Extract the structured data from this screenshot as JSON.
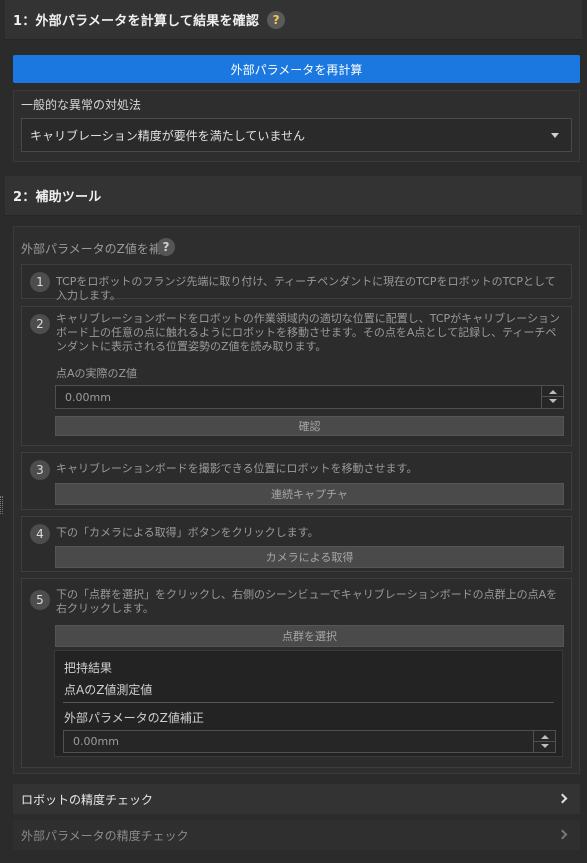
{
  "section1": {
    "title": "1：外部パラメータを計算して結果を確認",
    "help": "?",
    "recalc_button": "外部パラメータを再計算",
    "common_issues_label": "一般的な異常の対処法",
    "issue_selected": "キャリブレーション精度が要件を満たしていません"
  },
  "section2": {
    "title": "2：補助ツール",
    "z_correction_label": "外部パラメータのZ値を補正",
    "help": "?",
    "steps": [
      {
        "num": "1",
        "text": "TCPをロボットのフランジ先端に取り付け、ティーチペンダントに現在のTCPをロボットのTCPとして入力します。"
      },
      {
        "num": "2",
        "text": "キャリブレーションボードをロボットの作業領域内の適切な位置に配置し、TCPがキャリブレーションボード上の任意の点に触れるようにロボットを移動させます。その点をA点として記録し、ティーチペンダントに表示される位置姿勢のZ値を読み取ります。",
        "field_label": "点Aの実際のZ値",
        "field_value": "0.00mm",
        "button": "確認"
      },
      {
        "num": "3",
        "text": "キャリブレーションボードを撮影できる位置にロボットを移動させます。",
        "button": "連続キャプチャ"
      },
      {
        "num": "4",
        "text": "下の「カメラによる取得」ボタンをクリックします。",
        "button": "カメラによる取得"
      },
      {
        "num": "5",
        "text": "下の「点群を選択」をクリックし、右側のシーンビューでキャリブレーションボードの点群上の点Aを右クリックします。",
        "button": "点群を選択",
        "result_title": "把持結果",
        "result_z_label": "点AのZ値測定値",
        "correction_label": "外部パラメータのZ値補正",
        "correction_value": "0.00mm"
      }
    ]
  },
  "collapsibles": {
    "robot_accuracy": "ロボットの精度チェック",
    "extrinsic_accuracy": "外部パラメータの精度チェック"
  },
  "colors": {
    "primary": "#1b78e0",
    "help_accent": "#f2c94c",
    "background": "#2b2b2b"
  }
}
